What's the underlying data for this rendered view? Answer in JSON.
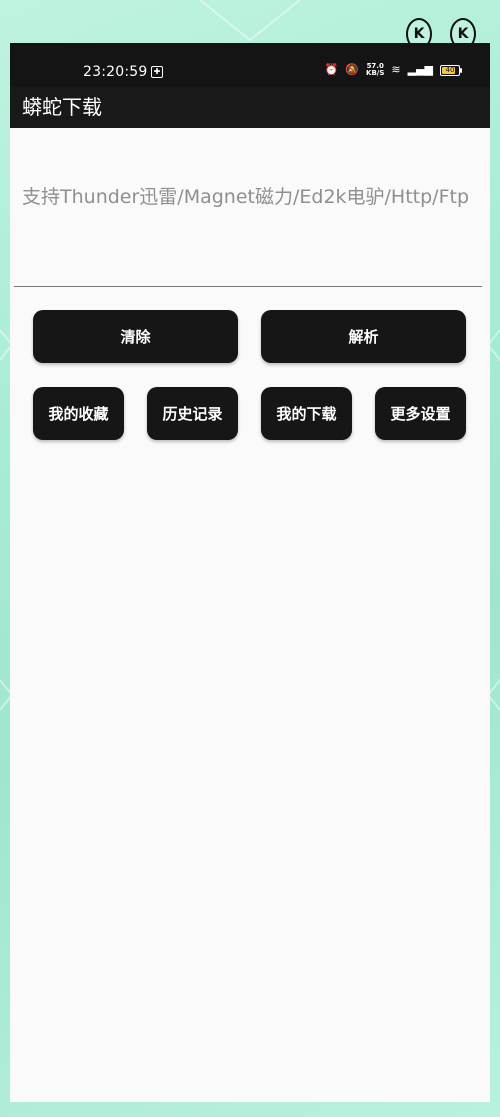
{
  "status_bar": {
    "time": "23:20:59",
    "network_speed": "57.0",
    "network_speed_unit": "KB/S",
    "battery": "40"
  },
  "app": {
    "title": "蟒蛇下载"
  },
  "input": {
    "placeholder": "支持Thunder迅雷/Magnet磁力/Ed2k电驴/Http/Ftp",
    "value": ""
  },
  "buttons": {
    "clear": "清除",
    "parse": "解析",
    "favorites": "我的收藏",
    "history": "历史记录",
    "downloads": "我的下载",
    "settings": "更多设置"
  },
  "colors": {
    "background": "#a7ecd3",
    "button": "#161616",
    "appbar": "#191919"
  }
}
